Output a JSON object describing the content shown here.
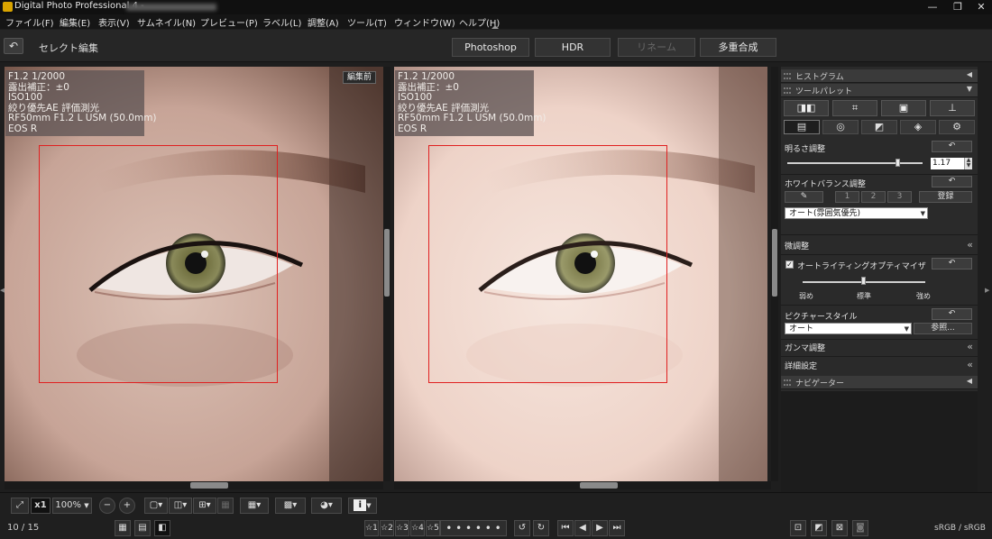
{
  "window": {
    "title": "Digital Photo Professional 4 -",
    "controls": {
      "minimize": "—",
      "restore": "❐",
      "close": "✕"
    }
  },
  "menu": [
    "ファイル(F)",
    "編集(E)",
    "表示(V)",
    "サムネイル(N)",
    "プレビュー(P)",
    "ラベル(L)",
    "調整(A)",
    "ツール(T)",
    "ウィンドウ(W)",
    "ヘルプ(H)"
  ],
  "toolbar": {
    "back_icon": "↶",
    "title": "セレクト編集",
    "buttons": [
      {
        "label": "Photoshop",
        "enabled": true
      },
      {
        "label": "HDR",
        "enabled": true
      },
      {
        "label": "リネーム",
        "enabled": false
      },
      {
        "label": "多重合成",
        "enabled": true
      }
    ]
  },
  "viewer": {
    "left": {
      "info": [
        "F1.2 1/2000",
        "露出補正：±0",
        "ISO100",
        "絞り優先AE 評価測光",
        "RF50mm F1.2 L USM (50.0mm)",
        "EOS R"
      ],
      "badge": "編集前"
    },
    "right": {
      "info": [
        "F1.2 1/2000",
        "露出補正：±0",
        "ISO100",
        "絞り優先AE 評価測光",
        "RF50mm F1.2 L USM (50.0mm)",
        "EOS R"
      ]
    }
  },
  "panel": {
    "histogram_header": "ヒストグラム",
    "tool_palette_header": "ツールパレット",
    "navigator_header": "ナビゲーター",
    "tool_tabs": [
      "◨◧",
      "⌗",
      "▣",
      "⊥"
    ],
    "sub_tabs": [
      "▤",
      "◎",
      "◩",
      "◈",
      "⚙"
    ],
    "brightness": {
      "label": "明るさ調整",
      "value": "1.17",
      "level": 0.82,
      "reset": "↶"
    },
    "white_balance": {
      "label": "ホワイトバランス調整",
      "reset": "↶",
      "eyedropper": "✎",
      "presets": [
        "1",
        "2",
        "3"
      ],
      "register": "登録",
      "selected": "オート(雰囲気優先)"
    },
    "fine_tune": {
      "label": "微調整",
      "chevron": "«"
    },
    "alo": {
      "checked": true,
      "check_mark": "✓",
      "label": "オートライティングオプティマイザ",
      "reset": "↶",
      "ticks": [
        "弱め",
        "標準",
        "強め"
      ],
      "level": 0.5
    },
    "picture_style": {
      "label": "ピクチャースタイル",
      "reset": "↶",
      "selected": "オート",
      "browse": "参照..."
    },
    "gamma": {
      "label": "ガンマ調整",
      "chevron": "«"
    },
    "detail": {
      "label": "詳細設定",
      "chevron": "«"
    }
  },
  "statusbar": {
    "fit_icon": "⤢",
    "zoom_x1": "x1",
    "zoom_value": "100%",
    "zoom_out": "−",
    "zoom_in": "+",
    "counter": "10 / 15",
    "ratings": [
      "☆1",
      "☆2",
      "☆3",
      "☆4",
      "☆5"
    ],
    "dots": "• • • • • •",
    "nav": [
      "⏮",
      "◀",
      "▶",
      "⏭"
    ],
    "color_space": "sRGB / sRGB",
    "info_icon": "i"
  },
  "colors": {
    "af_frame": "#e02020",
    "panel_bg": "#2a2a2a"
  }
}
